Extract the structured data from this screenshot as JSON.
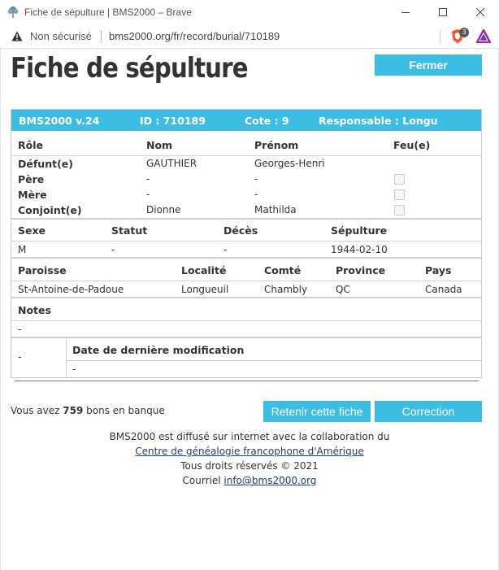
{
  "window": {
    "title": "Fiche de sépulture | BMS2000 – Brave",
    "insecure_label": "Non sécurisé",
    "url": "bms2000.org/fr/record/burial/710189",
    "shield_count": "3"
  },
  "page": {
    "title": "Fiche de sépulture",
    "close_label": "Fermer"
  },
  "record": {
    "header": {
      "version": "BMS2000 v.24",
      "id": "ID : 710189",
      "cote": "Cote : 9",
      "responsable": "Responsable : Longu"
    },
    "people_headers": [
      "Rôle",
      "Nom",
      "Prénom",
      "Feu(e)"
    ],
    "people": [
      {
        "role": "Défunt(e)",
        "nom": "GAUTHIER",
        "prenom": "Georges-Henri",
        "has_checkbox": false
      },
      {
        "role": "Père",
        "nom": "-",
        "prenom": "-",
        "has_checkbox": true
      },
      {
        "role": "Mère",
        "nom": "-",
        "prenom": "-",
        "has_checkbox": true
      },
      {
        "role": "Conjoint(e)",
        "nom": "Dionne",
        "prenom": "Mathilda",
        "has_checkbox": true
      }
    ],
    "status_headers": [
      "Sexe",
      "Statut",
      "Décès",
      "Sépulture"
    ],
    "status_values": [
      "M",
      "-",
      "-",
      "1944-02-10"
    ],
    "place_headers": [
      "Paroisse",
      "Localité",
      "Comté",
      "Province",
      "Pays"
    ],
    "place_values": [
      "St-Antoine-de-Padoue",
      "Longueuil",
      "Chambly",
      "QC",
      "Canada"
    ],
    "notes_label": "Notes",
    "notes_value": "-",
    "last_mod_left": "-",
    "last_mod_label": "Date de dernière modification",
    "last_mod_value": "-"
  },
  "footer": {
    "points_prefix": "Vous avez ",
    "points_value": "759",
    "points_suffix": " bons en banque",
    "keep_label": "Retenir cette fiche",
    "correction_label": "Correction",
    "collab_text": "BMS2000 est diffusé sur internet avec la collaboration du",
    "collab_link": "Centre de généalogie francophone d'Amérique",
    "rights": "Tous droits réservés © 2021",
    "mail_prefix": "Courriel ",
    "mail_link": "info@bms2000.org"
  },
  "colors": {
    "accent": "#3bbde4",
    "link": "#1d3f7a"
  }
}
